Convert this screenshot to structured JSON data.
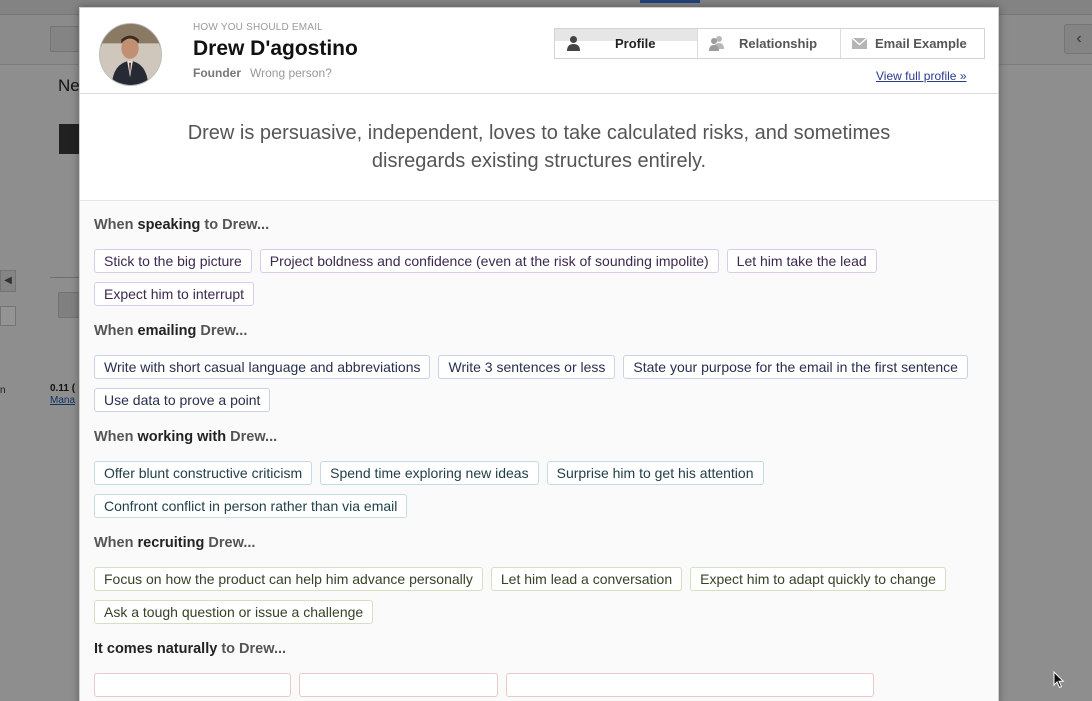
{
  "background": {
    "heading_fragment": "Ne",
    "small_bold": "0.11 (",
    "small_link": "Mana",
    "left_letter": "n",
    "right_button_glyph": "‹",
    "left_button_glyph": "◀"
  },
  "modal": {
    "kicker": "HOW YOU SHOULD EMAIL",
    "name": "Drew D'agostino",
    "role": "Founder",
    "wrong_person": "Wrong person?",
    "tabs": [
      {
        "label": "Profile",
        "icon": "person-icon",
        "active": true
      },
      {
        "label": "Relationship",
        "icon": "people-icon",
        "active": false
      },
      {
        "label": "Email Example",
        "icon": "envelope-icon",
        "active": false
      }
    ],
    "view_full_profile": "View full profile »",
    "summary": "Drew is persuasive, independent, loves to take calculated risks, and sometimes disregards existing structures entirely.",
    "sections": {
      "speaking": {
        "prefix": "When ",
        "verb": "speaking",
        "suffix": " to Drew...",
        "chips": [
          "Stick to the big picture",
          "Project boldness and confidence (even at the risk of sounding impolite)",
          "Let him take the lead",
          "Expect him to interrupt"
        ]
      },
      "emailing": {
        "prefix": "When ",
        "verb": "emailing",
        "suffix": " Drew...",
        "chips": [
          "Write with short casual language and abbreviations",
          "Write 3 sentences or less",
          "State your purpose for the email in the first sentence",
          "Use data to prove a point"
        ]
      },
      "working": {
        "prefix": "When ",
        "verb": "working with",
        "suffix": " Drew...",
        "chips": [
          "Offer blunt constructive criticism",
          "Spend time exploring new ideas",
          "Surprise him to get his attention",
          "Confront conflict in person rather than via email"
        ]
      },
      "recruiting": {
        "prefix": "When ",
        "verb": "recruiting",
        "suffix": " Drew...",
        "chips": [
          "Focus on how the product can help him advance personally",
          "Let him lead a conversation",
          "Expect him to adapt quickly to change",
          "Ask a tough question or issue a challenge"
        ]
      },
      "naturally": {
        "prefix": "",
        "verb": "It comes naturally",
        "suffix": " to Drew..."
      }
    }
  }
}
